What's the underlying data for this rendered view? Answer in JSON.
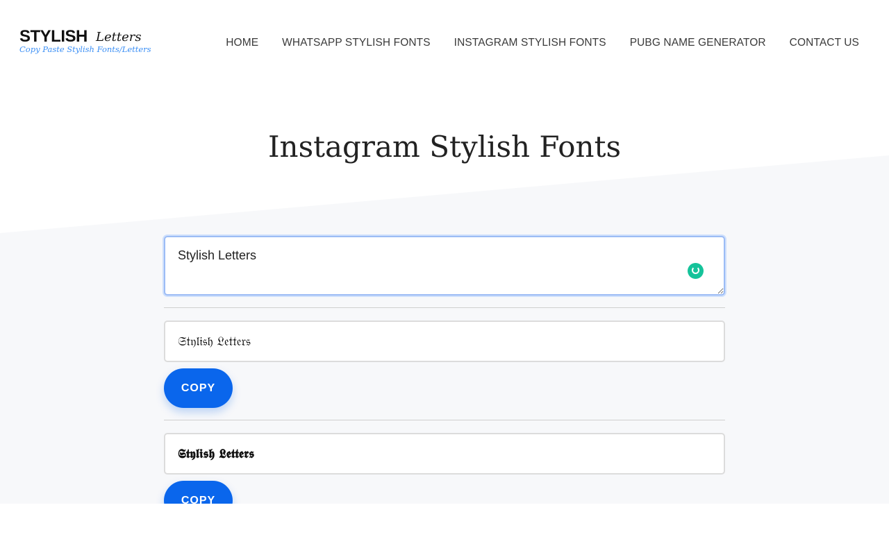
{
  "brand": {
    "logo_main": "STYLISH",
    "logo_script": "Letters",
    "logo_tagline": "Copy Paste Stylish Fonts/Letters"
  },
  "nav": {
    "items": [
      {
        "label": "HOME"
      },
      {
        "label": "WHATSAPP STYLISH FONTS"
      },
      {
        "label": "INSTAGRAM STYLISH FONTS"
      },
      {
        "label": "PUBG NAME GENERATOR"
      },
      {
        "label": "CONTACT US"
      }
    ]
  },
  "page": {
    "title": "Instagram Stylish Fonts"
  },
  "input": {
    "value": "Stylish Letters"
  },
  "icons": {
    "grammar": "grammarly-icon"
  },
  "results": [
    {
      "text": "𝔖𝔱𝔶𝔩𝔦𝔰𝔥 𝔏𝔢𝔱𝔱𝔢𝔯𝔰",
      "button": "COPY"
    },
    {
      "text": "𝕾𝖙𝖞𝖑𝖎𝖘𝖍 𝕷𝖊𝖙𝖙𝖊𝖗𝖘",
      "button": "COPY"
    }
  ],
  "colors": {
    "accent": "#0a66ec",
    "tagline": "#3b8ff5",
    "grammar": "#15c39a"
  }
}
